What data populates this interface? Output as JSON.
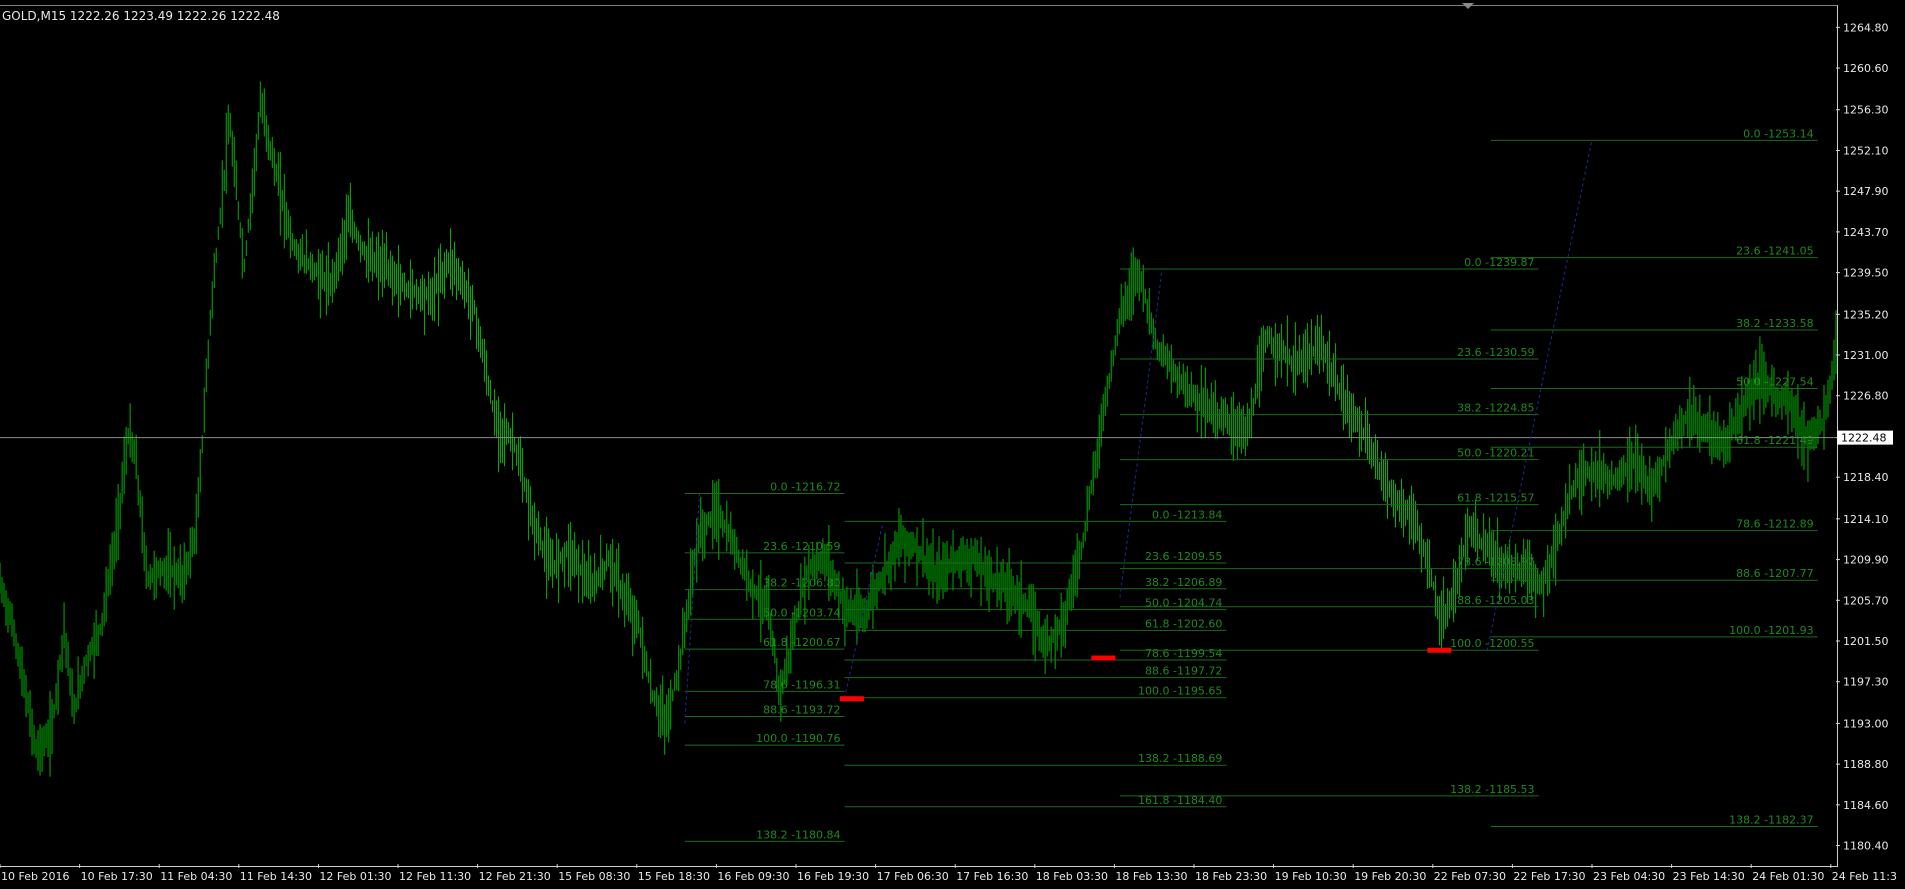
{
  "title": "GOLD,M15  1222.26 1223.49 1222.26 1222.48",
  "colors": {
    "background": "#000000",
    "candles": "#00b400",
    "fib_lines": "#1a6e1a",
    "fib_labels": "#1f8a1f",
    "trend_lines": "#1c2a9e",
    "bid_line": "#8c8c8c",
    "markers": "#ff0000",
    "axis_text": "#e8e8e8"
  },
  "current_price_label": "1222.48",
  "y_axis_labels": [
    "1264.80",
    "1260.60",
    "1256.30",
    "1252.10",
    "1247.90",
    "1243.70",
    "1239.50",
    "1235.20",
    "1231.00",
    "1226.80",
    "1222.48",
    "1218.40",
    "1214.10",
    "1209.90",
    "1205.70",
    "1201.50",
    "1197.30",
    "1193.00",
    "1188.80",
    "1184.60",
    "1180.40"
  ],
  "x_axis_labels": [
    "10 Feb 2016",
    "10 Feb 17:30",
    "11 Feb 04:30",
    "11 Feb 14:30",
    "12 Feb 01:30",
    "12 Feb 11:30",
    "12 Feb 21:30",
    "15 Feb 08:30",
    "15 Feb 18:30",
    "16 Feb 09:30",
    "16 Feb 19:30",
    "17 Feb 06:30",
    "17 Feb 16:30",
    "18 Feb 03:30",
    "18 Feb 13:30",
    "18 Feb 23:30",
    "19 Feb 10:30",
    "19 Feb 20:30",
    "22 Feb 07:30",
    "22 Feb 17:30",
    "23 Feb 04:30",
    "23 Feb 14:30",
    "24 Feb 01:30",
    "24 Feb 11:3"
  ],
  "chart_data": {
    "type": "candlestick",
    "symbol": "GOLD",
    "timeframe": "M15",
    "ohlc": {
      "open": 1222.26,
      "high": 1223.49,
      "low": 1222.26,
      "close": 1222.48
    },
    "ylim": [
      1178.5,
      1267.0
    ],
    "price_path": [
      [
        0,
        1207.5
      ],
      [
        0.007,
        1203
      ],
      [
        0.014,
        1196
      ],
      [
        0.02,
        1190
      ],
      [
        0.028,
        1192
      ],
      [
        0.035,
        1203
      ],
      [
        0.04,
        1194
      ],
      [
        0.046,
        1199
      ],
      [
        0.055,
        1203
      ],
      [
        0.063,
        1212
      ],
      [
        0.07,
        1223
      ],
      [
        0.074,
        1220
      ],
      [
        0.08,
        1208
      ],
      [
        0.09,
        1209
      ],
      [
        0.1,
        1208
      ],
      [
        0.107,
        1213
      ],
      [
        0.115,
        1236
      ],
      [
        0.125,
        1255
      ],
      [
        0.133,
        1240
      ],
      [
        0.142,
        1257
      ],
      [
        0.15,
        1250
      ],
      [
        0.16,
        1242
      ],
      [
        0.17,
        1240
      ],
      [
        0.18,
        1238
      ],
      [
        0.19,
        1245
      ],
      [
        0.2,
        1241
      ],
      [
        0.21,
        1240
      ],
      [
        0.22,
        1238
      ],
      [
        0.235,
        1237
      ],
      [
        0.245,
        1241
      ],
      [
        0.258,
        1236
      ],
      [
        0.263,
        1231
      ],
      [
        0.27,
        1224
      ],
      [
        0.28,
        1222
      ],
      [
        0.29,
        1214
      ],
      [
        0.3,
        1209
      ],
      [
        0.31,
        1211
      ],
      [
        0.322,
        1207
      ],
      [
        0.332,
        1210
      ],
      [
        0.34,
        1206
      ],
      [
        0.348,
        1203
      ],
      [
        0.355,
        1196
      ],
      [
        0.363,
        1193
      ],
      [
        0.37,
        1199
      ],
      [
        0.38,
        1212
      ],
      [
        0.39,
        1215
      ],
      [
        0.398,
        1212
      ],
      [
        0.41,
        1207
      ],
      [
        0.418,
        1205
      ],
      [
        0.425,
        1196
      ],
      [
        0.433,
        1203
      ],
      [
        0.44,
        1209
      ],
      [
        0.45,
        1210
      ],
      [
        0.46,
        1205
      ],
      [
        0.47,
        1204
      ],
      [
        0.48,
        1208
      ],
      [
        0.49,
        1212
      ],
      [
        0.5,
        1211
      ],
      [
        0.51,
        1208
      ],
      [
        0.52,
        1210
      ],
      [
        0.53,
        1210
      ],
      [
        0.54,
        1208
      ],
      [
        0.55,
        1207
      ],
      [
        0.56,
        1205
      ],
      [
        0.565,
        1203
      ],
      [
        0.57,
        1201
      ],
      [
        0.58,
        1204
      ],
      [
        0.59,
        1212
      ],
      [
        0.6,
        1224
      ],
      [
        0.61,
        1235
      ],
      [
        0.62,
        1240
      ],
      [
        0.63,
        1232
      ],
      [
        0.64,
        1229
      ],
      [
        0.655,
        1226
      ],
      [
        0.67,
        1224
      ],
      [
        0.68,
        1223
      ],
      [
        0.69,
        1233
      ],
      [
        0.705,
        1230
      ],
      [
        0.72,
        1232
      ],
      [
        0.73,
        1227
      ],
      [
        0.74,
        1224
      ],
      [
        0.75,
        1220
      ],
      [
        0.76,
        1216
      ],
      [
        0.77,
        1214
      ],
      [
        0.78,
        1208
      ],
      [
        0.785,
        1203
      ],
      [
        0.79,
        1205
      ],
      [
        0.8,
        1213
      ],
      [
        0.81,
        1211
      ],
      [
        0.82,
        1209
      ],
      [
        0.83,
        1209
      ],
      [
        0.84,
        1207
      ],
      [
        0.85,
        1213
      ],
      [
        0.86,
        1219
      ],
      [
        0.87,
        1219
      ],
      [
        0.88,
        1218
      ],
      [
        0.89,
        1220
      ],
      [
        0.9,
        1217
      ],
      [
        0.91,
        1222
      ],
      [
        0.92,
        1225
      ],
      [
        0.93,
        1223
      ],
      [
        0.94,
        1222
      ],
      [
        0.95,
        1226
      ],
      [
        0.96,
        1229
      ],
      [
        0.965,
        1227
      ],
      [
        0.975,
        1226
      ],
      [
        0.985,
        1222
      ],
      [
        0.993,
        1224
      ],
      [
        1.0,
        1231
      ]
    ],
    "fib_sets": [
      {
        "x_range_bars": [
          0.373,
          0.46
        ],
        "levels": [
          {
            "label": "0.0 -1216.72",
            "price": 1216.72
          },
          {
            "label": "23.6 -1210.59",
            "price": 1210.59
          },
          {
            "label": "38.2 -1206.80",
            "price": 1206.8
          },
          {
            "label": "50.0 -1203.74",
            "price": 1203.74
          },
          {
            "label": "61.8 -1200.67",
            "price": 1200.67
          },
          {
            "label": "78.6 -1196.31",
            "price": 1196.31
          },
          {
            "label": "88.6 -1193.72",
            "price": 1193.72
          },
          {
            "label": "100.0 -1190.76",
            "price": 1190.76
          },
          {
            "label": "138.2  -1180.84",
            "price": 1180.84
          }
        ]
      },
      {
        "x_range_bars": [
          0.46,
          0.668
        ],
        "levels": [
          {
            "label": "0.0 -1213.84",
            "price": 1213.84
          },
          {
            "label": "23.6 -1209.55",
            "price": 1209.55
          },
          {
            "label": "38.2 -1206.89",
            "price": 1206.89
          },
          {
            "label": "50.0 -1204.74",
            "price": 1204.74
          },
          {
            "label": "61.8 -1202.60",
            "price": 1202.6
          },
          {
            "label": "78.6 -1199.54",
            "price": 1199.54
          },
          {
            "label": "88.6 -1197.72",
            "price": 1197.72
          },
          {
            "label": "100.0 -1195.65",
            "price": 1195.65
          },
          {
            "label": "138.2  -1188.69",
            "price": 1188.69
          },
          {
            "label": "161.8 -1184.40",
            "price": 1184.4
          }
        ]
      },
      {
        "x_range_bars": [
          0.61,
          0.838
        ],
        "levels": [
          {
            "label": "0.0 -1239.87",
            "price": 1239.87
          },
          {
            "label": "23.6 -1230.59",
            "price": 1230.59
          },
          {
            "label": "38.2 -1224.85",
            "price": 1224.85
          },
          {
            "label": "50.0 -1220.21",
            "price": 1220.21
          },
          {
            "label": "61.8 -1215.57",
            "price": 1215.57
          },
          {
            "label": "78.6 -1208.97",
            "price": 1208.97
          },
          {
            "label": "88.6 -1205.03",
            "price": 1205.03
          },
          {
            "label": "100.0 -1200.55",
            "price": 1200.55
          },
          {
            "label": "138.2  -1185.53",
            "price": 1185.53
          }
        ]
      },
      {
        "x_range_bars": [
          0.812,
          0.99
        ],
        "levels": [
          {
            "label": "0.0 -1253.14",
            "price": 1253.14
          },
          {
            "label": "23.6 -1241.05",
            "price": 1241.05
          },
          {
            "label": "38.2 -1233.58",
            "price": 1233.58
          },
          {
            "label": "50.0 -1227.54",
            "price": 1227.54
          },
          {
            "label": "61.8 -1221.49",
            "price": 1221.49
          },
          {
            "label": "78.6 -1212.89",
            "price": 1212.89
          },
          {
            "label": "88.6 -1207.77",
            "price": 1207.77
          },
          {
            "label": "100.0 -1201.93",
            "price": 1201.93
          },
          {
            "label": "138.2  -1182.37",
            "price": 1182.37
          }
        ]
      }
    ],
    "trend_lines": [
      {
        "from": [
          0.373,
          1193.0
        ],
        "to": [
          0.381,
          1216.7
        ]
      },
      {
        "from": [
          0.46,
          1195.6
        ],
        "to": [
          0.481,
          1213.8
        ]
      },
      {
        "from": [
          0.61,
          1206.0
        ],
        "to": [
          0.633,
          1239.9
        ]
      },
      {
        "from": [
          0.81,
          1200.5
        ],
        "to": [
          0.867,
          1253.1
        ]
      }
    ],
    "markers": [
      {
        "x": 0.464,
        "price": 1195.6
      },
      {
        "x": 0.601,
        "price": 1199.8
      },
      {
        "x": 0.784,
        "price": 1200.6
      }
    ],
    "grid": false
  }
}
